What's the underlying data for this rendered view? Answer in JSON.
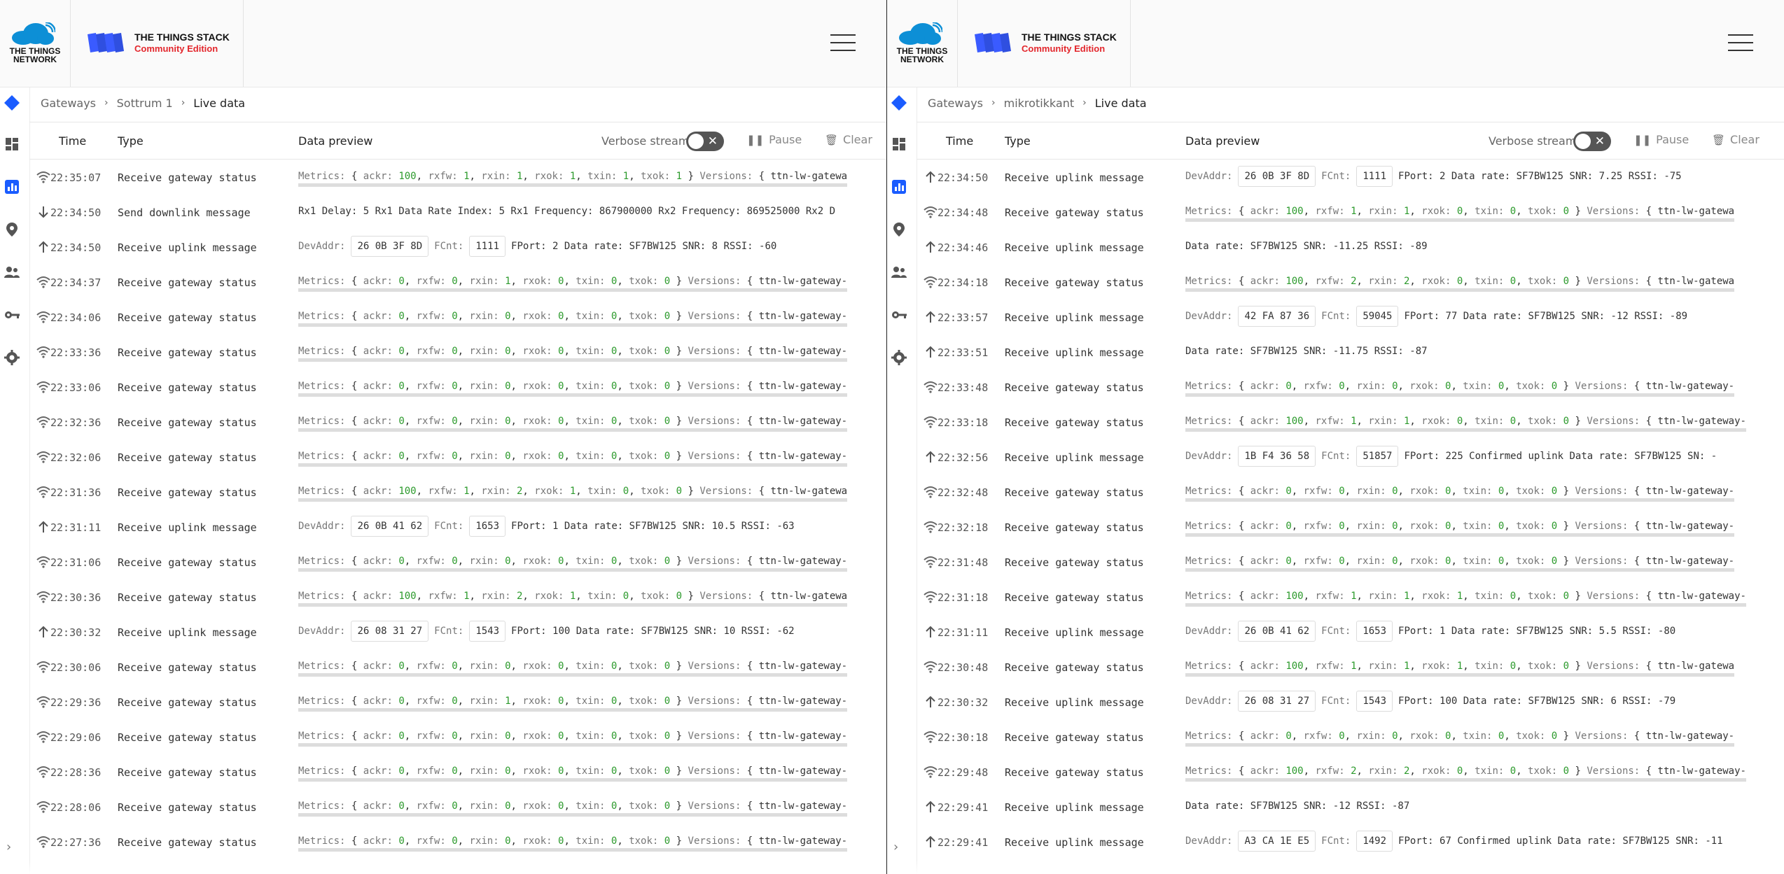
{
  "brand": {
    "ttn_line1": "THE THINGS",
    "ttn_line2": "NETWORK",
    "stack_title": "THE THINGS STACK",
    "stack_subtitle": "Community Edition"
  },
  "table_headers": {
    "time": "Time",
    "type": "Type",
    "preview": "Data preview",
    "verbose": "Verbose stream",
    "pause": "Pause",
    "clear": "Clear"
  },
  "left": {
    "breadcrumb": [
      "Gateways",
      "Sottrum 1",
      "Live data"
    ],
    "rows": [
      {
        "icon": "wifi",
        "time": "22:35:07",
        "type": "Receive gateway status",
        "preview": "metrics",
        "m": [
          "100",
          "1",
          "1",
          "1",
          "1",
          "1"
        ],
        "tail": "ttn-lw-gatewa"
      },
      {
        "icon": "down",
        "time": "22:34:50",
        "type": "Send downlink message",
        "preview": "downlink",
        "text": "Rx1 Delay: 5  Rx1 Data Rate Index: 5  Rx1 Frequency: 867900000  Rx2 Frequency: 869525000  Rx2 D"
      },
      {
        "icon": "up",
        "time": "22:34:50",
        "type": "Receive uplink message",
        "preview": "uplink",
        "devaddr": "26 0B 3F 8D",
        "fcnt": "1111",
        "rest": "FPort: 2  Data rate: SF7BW125  SNR: 8  RSSI: -60"
      },
      {
        "icon": "wifi",
        "time": "22:34:37",
        "type": "Receive gateway status",
        "preview": "metrics",
        "m": [
          "0",
          "0",
          "1",
          "0",
          "0",
          "0"
        ],
        "tail": "ttn-lw-gateway-"
      },
      {
        "icon": "wifi",
        "time": "22:34:06",
        "type": "Receive gateway status",
        "preview": "metrics",
        "m": [
          "0",
          "0",
          "0",
          "0",
          "0",
          "0"
        ],
        "tail": "ttn-lw-gateway-"
      },
      {
        "icon": "wifi",
        "time": "22:33:36",
        "type": "Receive gateway status",
        "preview": "metrics",
        "m": [
          "0",
          "0",
          "0",
          "0",
          "0",
          "0"
        ],
        "tail": "ttn-lw-gateway-"
      },
      {
        "icon": "wifi",
        "time": "22:33:06",
        "type": "Receive gateway status",
        "preview": "metrics",
        "m": [
          "0",
          "0",
          "0",
          "0",
          "0",
          "0"
        ],
        "tail": "ttn-lw-gateway-"
      },
      {
        "icon": "wifi",
        "time": "22:32:36",
        "type": "Receive gateway status",
        "preview": "metrics",
        "m": [
          "0",
          "0",
          "0",
          "0",
          "0",
          "0"
        ],
        "tail": "ttn-lw-gateway-"
      },
      {
        "icon": "wifi",
        "time": "22:32:06",
        "type": "Receive gateway status",
        "preview": "metrics",
        "m": [
          "0",
          "0",
          "0",
          "0",
          "0",
          "0"
        ],
        "tail": "ttn-lw-gateway-"
      },
      {
        "icon": "wifi",
        "time": "22:31:36",
        "type": "Receive gateway status",
        "preview": "metrics",
        "m": [
          "100",
          "1",
          "2",
          "1",
          "0",
          "0"
        ],
        "tail": "ttn-lw-gatewa"
      },
      {
        "icon": "up",
        "time": "22:31:11",
        "type": "Receive uplink message",
        "preview": "uplink",
        "devaddr": "26 0B 41 62",
        "fcnt": "1653",
        "rest": "FPort: 1  Data rate: SF7BW125  SNR: 10.5  RSSI: -63"
      },
      {
        "icon": "wifi",
        "time": "22:31:06",
        "type": "Receive gateway status",
        "preview": "metrics",
        "m": [
          "0",
          "0",
          "0",
          "0",
          "0",
          "0"
        ],
        "tail": "ttn-lw-gateway-"
      },
      {
        "icon": "wifi",
        "time": "22:30:36",
        "type": "Receive gateway status",
        "preview": "metrics",
        "m": [
          "100",
          "1",
          "2",
          "1",
          "0",
          "0"
        ],
        "tail": "ttn-lw-gatewa"
      },
      {
        "icon": "up",
        "time": "22:30:32",
        "type": "Receive uplink message",
        "preview": "uplink",
        "devaddr": "26 08 31 27",
        "fcnt": "1543",
        "rest": "FPort: 100  Data rate: SF7BW125  SNR: 10  RSSI: -62"
      },
      {
        "icon": "wifi",
        "time": "22:30:06",
        "type": "Receive gateway status",
        "preview": "metrics",
        "m": [
          "0",
          "0",
          "0",
          "0",
          "0",
          "0"
        ],
        "tail": "ttn-lw-gateway-"
      },
      {
        "icon": "wifi",
        "time": "22:29:36",
        "type": "Receive gateway status",
        "preview": "metrics",
        "m": [
          "0",
          "0",
          "1",
          "0",
          "0",
          "0"
        ],
        "tail": "ttn-lw-gateway-"
      },
      {
        "icon": "wifi",
        "time": "22:29:06",
        "type": "Receive gateway status",
        "preview": "metrics",
        "m": [
          "0",
          "0",
          "0",
          "0",
          "0",
          "0"
        ],
        "tail": "ttn-lw-gateway-"
      },
      {
        "icon": "wifi",
        "time": "22:28:36",
        "type": "Receive gateway status",
        "preview": "metrics",
        "m": [
          "0",
          "0",
          "0",
          "0",
          "0",
          "0"
        ],
        "tail": "ttn-lw-gateway-"
      },
      {
        "icon": "wifi",
        "time": "22:28:06",
        "type": "Receive gateway status",
        "preview": "metrics",
        "m": [
          "0",
          "0",
          "0",
          "0",
          "0",
          "0"
        ],
        "tail": "ttn-lw-gateway-"
      },
      {
        "icon": "wifi",
        "time": "22:27:36",
        "type": "Receive gateway status",
        "preview": "metrics",
        "m": [
          "0",
          "0",
          "0",
          "0",
          "0",
          "0"
        ],
        "tail": "ttn-lw-gateway-"
      }
    ]
  },
  "right": {
    "breadcrumb": [
      "Gateways",
      "mikrotikkant",
      "Live data"
    ],
    "rows": [
      {
        "icon": "up",
        "time": "22:34:50",
        "type": "Receive uplink message",
        "preview": "uplink",
        "devaddr": "26 0B 3F 8D",
        "fcnt": "1111",
        "rest": "FPort: 2  Data rate: SF7BW125  SNR: 7.25  RSSI: -75"
      },
      {
        "icon": "wifi",
        "time": "22:34:48",
        "type": "Receive gateway status",
        "preview": "metrics",
        "m": [
          "100",
          "1",
          "1",
          "0",
          "0",
          "0"
        ],
        "tail": "ttn-lw-gatewa"
      },
      {
        "icon": "up",
        "time": "22:34:46",
        "type": "Receive uplink message",
        "preview": "plain",
        "text": "Data rate: SF7BW125  SNR: -11.25  RSSI: -89"
      },
      {
        "icon": "wifi",
        "time": "22:34:18",
        "type": "Receive gateway status",
        "preview": "metrics",
        "m": [
          "100",
          "2",
          "2",
          "0",
          "0",
          "0"
        ],
        "tail": "ttn-lw-gatewa"
      },
      {
        "icon": "up",
        "time": "22:33:57",
        "type": "Receive uplink message",
        "preview": "uplink",
        "devaddr": "42 FA 87 36",
        "fcnt": "59045",
        "rest": "FPort: 77  Data rate: SF7BW125  SNR: -12  RSSI: -89"
      },
      {
        "icon": "up",
        "time": "22:33:51",
        "type": "Receive uplink message",
        "preview": "plain",
        "text": "Data rate: SF7BW125  SNR: -11.75  RSSI: -87"
      },
      {
        "icon": "wifi",
        "time": "22:33:48",
        "type": "Receive gateway status",
        "preview": "metrics",
        "m": [
          "0",
          "0",
          "0",
          "0",
          "0",
          "0"
        ],
        "tail": "ttn-lw-gateway-"
      },
      {
        "icon": "wifi",
        "time": "22:33:18",
        "type": "Receive gateway status",
        "preview": "metrics",
        "m": [
          "100",
          "1",
          "1",
          "0",
          "0",
          "0"
        ],
        "tail": "ttn-lw-gateway-"
      },
      {
        "icon": "up",
        "time": "22:32:56",
        "type": "Receive uplink message",
        "preview": "uplink",
        "devaddr": "1B F4 36 58",
        "fcnt": "51857",
        "rest": "FPort: 225  Confirmed uplink  Data rate: SF7BW125  SN: -"
      },
      {
        "icon": "wifi",
        "time": "22:32:48",
        "type": "Receive gateway status",
        "preview": "metrics",
        "m": [
          "0",
          "0",
          "0",
          "0",
          "0",
          "0"
        ],
        "tail": "ttn-lw-gateway-"
      },
      {
        "icon": "wifi",
        "time": "22:32:18",
        "type": "Receive gateway status",
        "preview": "metrics",
        "m": [
          "0",
          "0",
          "0",
          "0",
          "0",
          "0"
        ],
        "tail": "ttn-lw-gateway-"
      },
      {
        "icon": "wifi",
        "time": "22:31:48",
        "type": "Receive gateway status",
        "preview": "metrics",
        "m": [
          "0",
          "0",
          "0",
          "0",
          "0",
          "0"
        ],
        "tail": "ttn-lw-gateway-"
      },
      {
        "icon": "wifi",
        "time": "22:31:18",
        "type": "Receive gateway status",
        "preview": "metrics",
        "m": [
          "100",
          "1",
          "1",
          "1",
          "0",
          "0"
        ],
        "tail": "ttn-lw-gateway-"
      },
      {
        "icon": "up",
        "time": "22:31:11",
        "type": "Receive uplink message",
        "preview": "uplink",
        "devaddr": "26 0B 41 62",
        "fcnt": "1653",
        "rest": "FPort: 1  Data rate: SF7BW125  SNR: 5.5  RSSI: -80"
      },
      {
        "icon": "wifi",
        "time": "22:30:48",
        "type": "Receive gateway status",
        "preview": "metrics",
        "m": [
          "100",
          "1",
          "1",
          "1",
          "0",
          "0"
        ],
        "tail": "ttn-lw-gatewa"
      },
      {
        "icon": "up",
        "time": "22:30:32",
        "type": "Receive uplink message",
        "preview": "uplink",
        "devaddr": "26 08 31 27",
        "fcnt": "1543",
        "rest": "FPort: 100  Data rate: SF7BW125  SNR: 6  RSSI: -79"
      },
      {
        "icon": "wifi",
        "time": "22:30:18",
        "type": "Receive gateway status",
        "preview": "metrics",
        "m": [
          "0",
          "0",
          "0",
          "0",
          "0",
          "0"
        ],
        "tail": "ttn-lw-gateway-"
      },
      {
        "icon": "wifi",
        "time": "22:29:48",
        "type": "Receive gateway status",
        "preview": "metrics",
        "m": [
          "100",
          "2",
          "2",
          "0",
          "0",
          "0"
        ],
        "tail": "ttn-lw-gateway-"
      },
      {
        "icon": "up",
        "time": "22:29:41",
        "type": "Receive uplink message",
        "preview": "plain",
        "text": "Data rate: SF7BW125  SNR: -12  RSSI: -87"
      },
      {
        "icon": "up",
        "time": "22:29:41",
        "type": "Receive uplink message",
        "preview": "uplink",
        "devaddr": "A3 CA 1E E5",
        "fcnt": "1492",
        "rest": "FPort: 67  Confirmed uplink  Data rate: SF7BW125  SNR: -11"
      }
    ]
  },
  "colors": {
    "accent": "#1a5cff",
    "brand_red": "#e3262c",
    "number_green": "#2c9a2c"
  }
}
